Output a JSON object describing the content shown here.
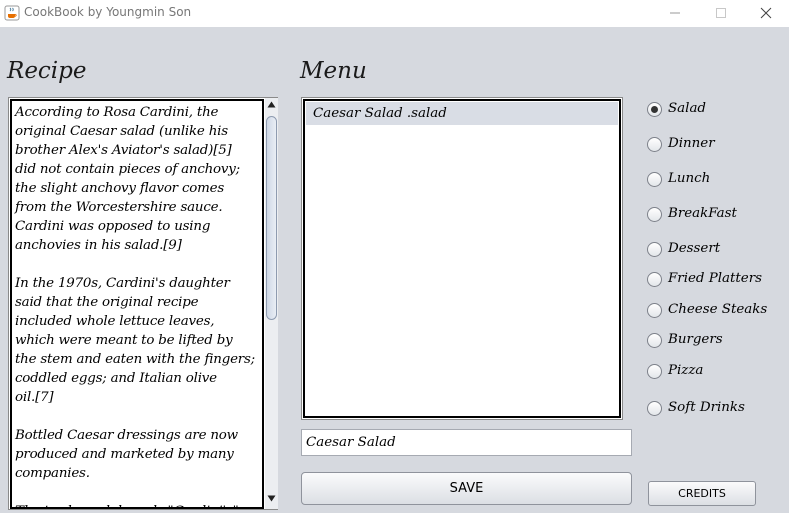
{
  "window": {
    "title": "CookBook by Youngmin Son",
    "icon": "java-coffee-icon"
  },
  "recipe": {
    "heading": "Recipe",
    "text": "According to Rosa Cardini, the\noriginal Caesar salad (unlike his\nbrother Alex's Aviator's salad)[5]\ndid not contain pieces of anchovy;\nthe slight anchovy flavor comes\nfrom the Worcestershire sauce.\nCardini was opposed to using\nanchovies in his salad.[9]\n\nIn the 1970s, Cardini's daughter\nsaid that the original recipe\nincluded whole lettuce leaves,\nwhich were meant to be lifted by\nthe stem and eaten with the fingers;\ncoddled eggs; and Italian olive\noil.[7]\n\nBottled Caesar dressings are now\nproduced and marketed by many\ncompanies.\n\nThe trademark brands \"Cardini's\","
  },
  "menu": {
    "heading": "Menu",
    "items": [
      "Caesar Salad .salad"
    ],
    "selected_index": 0,
    "name_field_value": "Caesar Salad",
    "save_label": "SAVE"
  },
  "categories": {
    "selected": "Salad",
    "options": [
      "Salad",
      "Dinner",
      "Lunch",
      "BreakFast",
      "Dessert",
      "Fried Platters",
      "Cheese Steaks",
      "Burgers",
      "Pizza",
      "Soft Drinks"
    ]
  },
  "credits_label": "CREDITS"
}
